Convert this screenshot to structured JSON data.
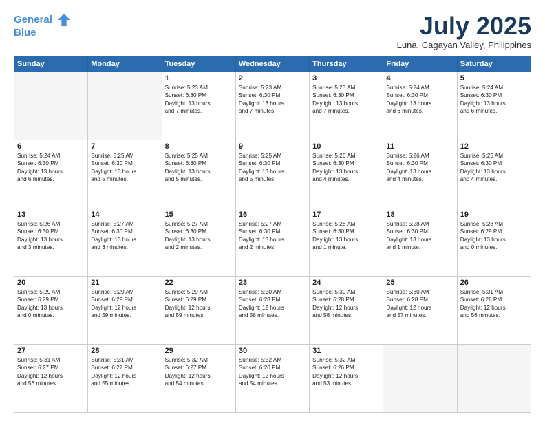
{
  "header": {
    "logo_line1": "General",
    "logo_line2": "Blue",
    "title": "July 2025",
    "location": "Luna, Cagayan Valley, Philippines"
  },
  "weekdays": [
    "Sunday",
    "Monday",
    "Tuesday",
    "Wednesday",
    "Thursday",
    "Friday",
    "Saturday"
  ],
  "weeks": [
    [
      {
        "day": "",
        "text": ""
      },
      {
        "day": "",
        "text": ""
      },
      {
        "day": "1",
        "text": "Sunrise: 5:23 AM\nSunset: 6:30 PM\nDaylight: 13 hours\nand 7 minutes."
      },
      {
        "day": "2",
        "text": "Sunrise: 5:23 AM\nSunset: 6:30 PM\nDaylight: 13 hours\nand 7 minutes."
      },
      {
        "day": "3",
        "text": "Sunrise: 5:23 AM\nSunset: 6:30 PM\nDaylight: 13 hours\nand 7 minutes."
      },
      {
        "day": "4",
        "text": "Sunrise: 5:24 AM\nSunset: 6:30 PM\nDaylight: 13 hours\nand 6 minutes."
      },
      {
        "day": "5",
        "text": "Sunrise: 5:24 AM\nSunset: 6:30 PM\nDaylight: 13 hours\nand 6 minutes."
      }
    ],
    [
      {
        "day": "6",
        "text": "Sunrise: 5:24 AM\nSunset: 6:30 PM\nDaylight: 13 hours\nand 6 minutes."
      },
      {
        "day": "7",
        "text": "Sunrise: 5:25 AM\nSunset: 6:30 PM\nDaylight: 13 hours\nand 5 minutes."
      },
      {
        "day": "8",
        "text": "Sunrise: 5:25 AM\nSunset: 6:30 PM\nDaylight: 13 hours\nand 5 minutes."
      },
      {
        "day": "9",
        "text": "Sunrise: 5:25 AM\nSunset: 6:30 PM\nDaylight: 13 hours\nand 5 minutes."
      },
      {
        "day": "10",
        "text": "Sunrise: 5:26 AM\nSunset: 6:30 PM\nDaylight: 13 hours\nand 4 minutes."
      },
      {
        "day": "11",
        "text": "Sunrise: 5:26 AM\nSunset: 6:30 PM\nDaylight: 13 hours\nand 4 minutes."
      },
      {
        "day": "12",
        "text": "Sunrise: 5:26 AM\nSunset: 6:30 PM\nDaylight: 13 hours\nand 4 minutes."
      }
    ],
    [
      {
        "day": "13",
        "text": "Sunrise: 5:26 AM\nSunset: 6:30 PM\nDaylight: 13 hours\nand 3 minutes."
      },
      {
        "day": "14",
        "text": "Sunrise: 5:27 AM\nSunset: 6:30 PM\nDaylight: 13 hours\nand 3 minutes."
      },
      {
        "day": "15",
        "text": "Sunrise: 5:27 AM\nSunset: 6:30 PM\nDaylight: 13 hours\nand 2 minutes."
      },
      {
        "day": "16",
        "text": "Sunrise: 5:27 AM\nSunset: 6:30 PM\nDaylight: 13 hours\nand 2 minutes."
      },
      {
        "day": "17",
        "text": "Sunrise: 5:28 AM\nSunset: 6:30 PM\nDaylight: 13 hours\nand 1 minute."
      },
      {
        "day": "18",
        "text": "Sunrise: 5:28 AM\nSunset: 6:30 PM\nDaylight: 13 hours\nand 1 minute."
      },
      {
        "day": "19",
        "text": "Sunrise: 5:28 AM\nSunset: 6:29 PM\nDaylight: 13 hours\nand 0 minutes."
      }
    ],
    [
      {
        "day": "20",
        "text": "Sunrise: 5:29 AM\nSunset: 6:29 PM\nDaylight: 13 hours\nand 0 minutes."
      },
      {
        "day": "21",
        "text": "Sunrise: 5:29 AM\nSunset: 6:29 PM\nDaylight: 12 hours\nand 59 minutes."
      },
      {
        "day": "22",
        "text": "Sunrise: 5:29 AM\nSunset: 6:29 PM\nDaylight: 12 hours\nand 59 minutes."
      },
      {
        "day": "23",
        "text": "Sunrise: 5:30 AM\nSunset: 6:28 PM\nDaylight: 12 hours\nand 58 minutes."
      },
      {
        "day": "24",
        "text": "Sunrise: 5:30 AM\nSunset: 6:28 PM\nDaylight: 12 hours\nand 58 minutes."
      },
      {
        "day": "25",
        "text": "Sunrise: 5:30 AM\nSunset: 6:28 PM\nDaylight: 12 hours\nand 57 minutes."
      },
      {
        "day": "26",
        "text": "Sunrise: 5:31 AM\nSunset: 6:28 PM\nDaylight: 12 hours\nand 56 minutes."
      }
    ],
    [
      {
        "day": "27",
        "text": "Sunrise: 5:31 AM\nSunset: 6:27 PM\nDaylight: 12 hours\nand 56 minutes."
      },
      {
        "day": "28",
        "text": "Sunrise: 5:31 AM\nSunset: 6:27 PM\nDaylight: 12 hours\nand 55 minutes."
      },
      {
        "day": "29",
        "text": "Sunrise: 5:32 AM\nSunset: 6:27 PM\nDaylight: 12 hours\nand 54 minutes."
      },
      {
        "day": "30",
        "text": "Sunrise: 5:32 AM\nSunset: 6:26 PM\nDaylight: 12 hours\nand 54 minutes."
      },
      {
        "day": "31",
        "text": "Sunrise: 5:32 AM\nSunset: 6:26 PM\nDaylight: 12 hours\nand 53 minutes."
      },
      {
        "day": "",
        "text": ""
      },
      {
        "day": "",
        "text": ""
      }
    ]
  ]
}
